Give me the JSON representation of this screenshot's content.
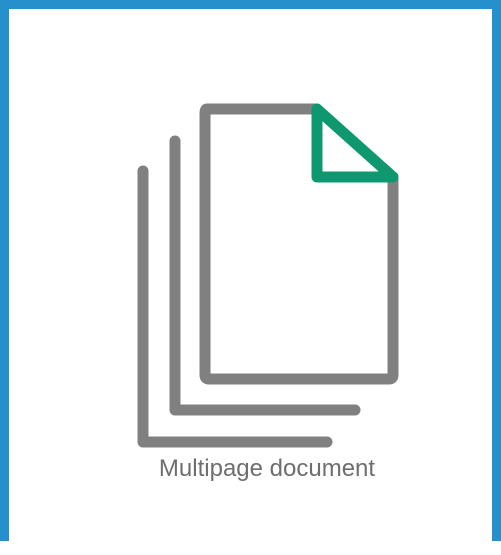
{
  "tile": {
    "caption": "Multipage document",
    "icon": "multipage-document-icon",
    "colors": {
      "border": "#2590cc",
      "pages": "#808080",
      "corner": "#0f9870"
    }
  }
}
